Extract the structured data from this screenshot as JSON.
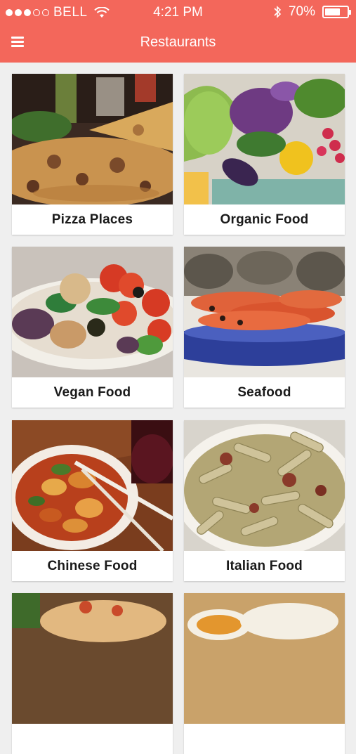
{
  "status_bar": {
    "carrier": "BELL",
    "time": "4:21 PM",
    "battery_percent": "70%",
    "battery_level": 0.7,
    "signal_dots_filled": 3,
    "signal_dots_total": 5
  },
  "app": {
    "title": "Restaurants",
    "accent_color": "#f3675b"
  },
  "categories": [
    {
      "label": "Pizza Places"
    },
    {
      "label": "Organic Food"
    },
    {
      "label": "Vegan Food"
    },
    {
      "label": "Seafood"
    },
    {
      "label": "Chinese Food"
    },
    {
      "label": "Italian Food"
    },
    {
      "label": ""
    },
    {
      "label": ""
    }
  ]
}
